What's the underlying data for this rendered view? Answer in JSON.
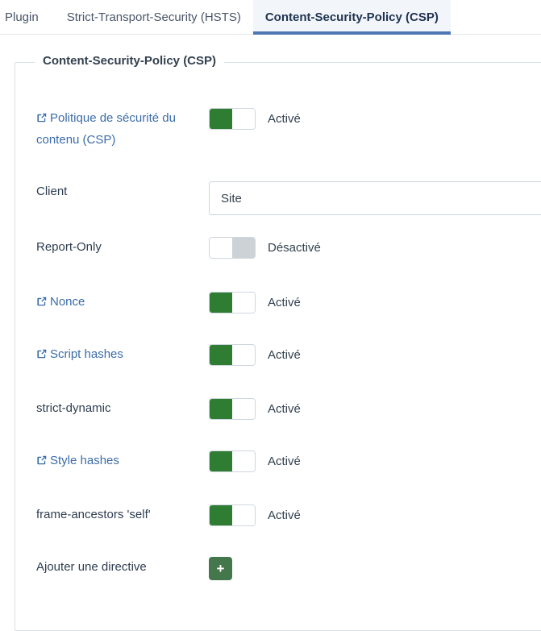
{
  "tabs": [
    {
      "label": "Plugin",
      "active": false
    },
    {
      "label": "Strict-Transport-Security (HSTS)",
      "active": false
    },
    {
      "label": "Content-Security-Policy (CSP)",
      "active": true
    }
  ],
  "panel": {
    "legend": "Content-Security-Policy (CSP)"
  },
  "state_labels": {
    "on": "Activé",
    "off": "Désactivé"
  },
  "colors": {
    "toggle_on": "#2e7d33",
    "toggle_off_track": "#cdd2d6",
    "link": "#3b6ca8",
    "accent_tab": "#4d77b3",
    "add_button": "#45774c"
  },
  "rows": [
    {
      "label": "Politique de sécurité du contenu (CSP)",
      "is_link": true,
      "icon": "external-link-icon",
      "control": "toggle",
      "state": "on",
      "state_label": "Activé",
      "name": "content-security-policy"
    },
    {
      "label": "Client",
      "is_link": false,
      "control": "textfield",
      "value": "Site",
      "placeholder": "",
      "name": "client"
    },
    {
      "label": "Report-Only",
      "is_link": false,
      "control": "toggle",
      "state": "off",
      "state_label": "Désactivé",
      "name": "report-only"
    },
    {
      "label": "Nonce",
      "is_link": true,
      "icon": "external-link-icon",
      "control": "toggle",
      "state": "on",
      "state_label": "Activé",
      "name": "nonce"
    },
    {
      "label": "Script hashes",
      "is_link": true,
      "icon": "external-link-icon",
      "control": "toggle",
      "state": "on",
      "state_label": "Activé",
      "name": "script-hashes"
    },
    {
      "label": "strict-dynamic",
      "is_link": false,
      "control": "toggle",
      "state": "on",
      "state_label": "Activé",
      "name": "strict-dynamic"
    },
    {
      "label": "Style hashes",
      "is_link": true,
      "icon": "external-link-icon",
      "control": "toggle",
      "state": "on",
      "state_label": "Activé",
      "name": "style-hashes"
    },
    {
      "label": "frame-ancestors 'self'",
      "is_link": false,
      "control": "toggle",
      "state": "on",
      "state_label": "Activé",
      "name": "frame-ancestors-self"
    },
    {
      "label": "Ajouter une directive",
      "is_link": false,
      "control": "add-button",
      "button_label": "+",
      "name": "add-directive"
    }
  ]
}
